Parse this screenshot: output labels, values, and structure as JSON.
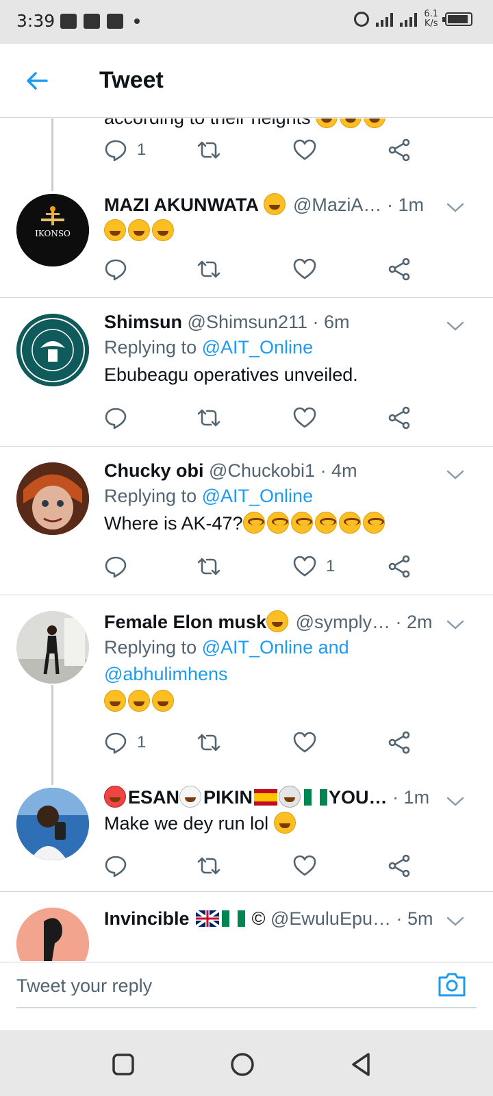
{
  "status_bar": {
    "time": "3:39",
    "net_speed_value": "6.1",
    "net_speed_unit": "K/s",
    "battery_level": 0.9
  },
  "header": {
    "title": "Tweet"
  },
  "partial_text": "according to their heights",
  "tweets": [
    {
      "name": "MAZI AKUNWATA",
      "handle": "@MaziA…",
      "time": "· 1m",
      "text": "",
      "counts": {
        "reply": "",
        "retweet": "",
        "like": ""
      }
    },
    {
      "name": "Shimsun",
      "handle": "@Shimsun211",
      "time": "· 6m",
      "replying_prefix": "Replying to",
      "replying_to": "@AIT_Online",
      "text": "Ebubeagu operatives unveiled.",
      "counts": {
        "reply": "",
        "retweet": "",
        "like": ""
      }
    },
    {
      "name": "Chucky obi",
      "handle": "@Chuckobi1",
      "time": "· 4m",
      "replying_prefix": "Replying to",
      "replying_to": "@AIT_Online",
      "text": "Where is AK-47?",
      "counts": {
        "reply": "",
        "retweet": "",
        "like": "1"
      }
    },
    {
      "name": "Female Elon musk",
      "handle": "@symply…",
      "time": "· 2m",
      "replying_prefix": "Replying to",
      "replying_to": "@AIT_Online and",
      "replying_to_2": "@abhulimhens",
      "text": "",
      "counts": {
        "reply": "1",
        "retweet": "",
        "like": ""
      }
    },
    {
      "name_parts": [
        "ESAN",
        "PIKIN",
        "YOU…"
      ],
      "time": "· 1m",
      "text": "Make we dey run lol",
      "counts": {
        "reply": "",
        "retweet": "",
        "like": ""
      }
    },
    {
      "name": "Invincible",
      "name_suffix": "©",
      "handle": "@EwuluEpu…",
      "time": "· 5m"
    }
  ],
  "top_actions": {
    "reply": "1"
  },
  "reply_bar": {
    "placeholder": "Tweet your reply"
  },
  "colors": {
    "accent": "#1d9bf0",
    "text": "#0f1419",
    "muted": "#536471",
    "divider": "#cfd9de"
  },
  "icons": [
    "back-arrow-icon",
    "reply-icon",
    "retweet-icon",
    "like-icon",
    "share-icon",
    "chevron-down-icon",
    "camera-icon",
    "square-nav-icon",
    "circle-nav-icon",
    "triangle-nav-icon"
  ]
}
